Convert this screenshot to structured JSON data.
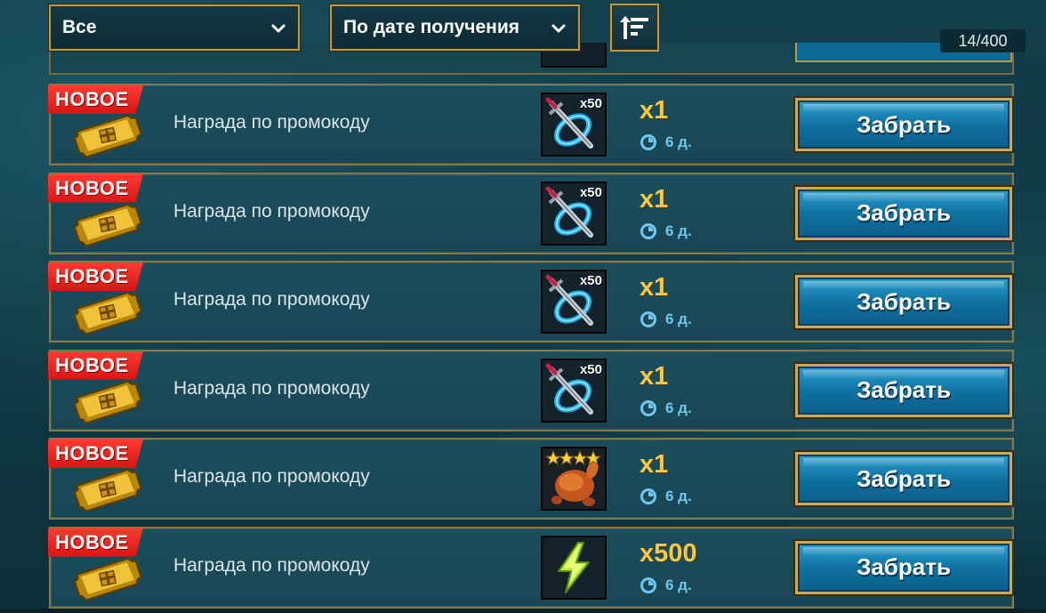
{
  "filters": {
    "category": "Все",
    "sort": "По дате получения",
    "count": "14/400"
  },
  "rows": [
    {
      "badge": "НОВОЕ",
      "description": "Награда по промокоду",
      "item": "sword-scroll",
      "item_qty": "x50",
      "qty": "x1",
      "timer": "6 д.",
      "button": "Забрать"
    },
    {
      "badge": "НОВОЕ",
      "description": "Награда по промокоду",
      "item": "sword-scroll",
      "item_qty": "x50",
      "qty": "x1",
      "timer": "6 д.",
      "button": "Забрать"
    },
    {
      "badge": "НОВОЕ",
      "description": "Награда по промокоду",
      "item": "sword-scroll",
      "item_qty": "x50",
      "qty": "x1",
      "timer": "6 д.",
      "button": "Забрать"
    },
    {
      "badge": "НОВОЕ",
      "description": "Награда по промокоду",
      "item": "sword-scroll",
      "item_qty": "x50",
      "qty": "x1",
      "timer": "6 д.",
      "button": "Забрать"
    },
    {
      "badge": "НОВОЕ",
      "description": "Награда по промокоду",
      "item": "roast-chicken-4-star",
      "item_qty": "",
      "qty": "x1",
      "timer": "6 д.",
      "button": "Забрать"
    },
    {
      "badge": "НОВОЕ",
      "description": "Награда по промокоду",
      "item": "energy-bolt",
      "item_qty": "",
      "qty": "x500",
      "timer": "6 д.",
      "button": "Забрать"
    }
  ],
  "colors": {
    "badge": "#e01f1a",
    "quantity": "#f2c94c",
    "timer": "#6ec8f0",
    "button": "#0e6f9e",
    "frame_gold": "#b79a4a"
  }
}
